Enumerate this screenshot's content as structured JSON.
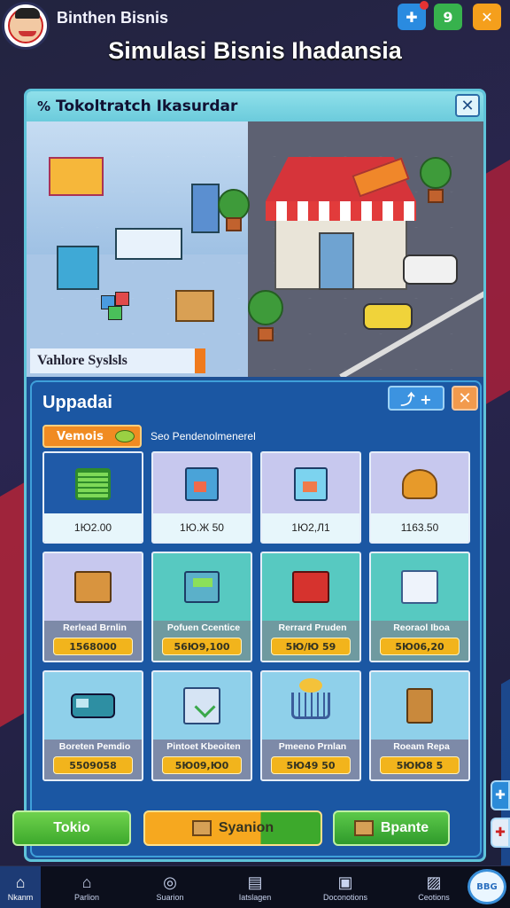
{
  "header": {
    "app_name": "Binthen Bisnis",
    "page_title": "Simulasi Bisnis Ihadansia",
    "buttons": [
      {
        "name": "puzzle-icon",
        "glyph": "✚"
      },
      {
        "name": "g-icon",
        "glyph": "9"
      },
      {
        "name": "tool-icon",
        "glyph": "✕"
      }
    ]
  },
  "window": {
    "title": "Tokoltratch Ikasurdar",
    "title_icon": "%",
    "close_glyph": "✕",
    "scene_label": "Vahlore Syslsls"
  },
  "panel": {
    "title": "Uppadai",
    "add_glyph": "⤴ +",
    "close_glyph": "✕",
    "filter_chip": "Vemois",
    "filter_desc": "Seo Pendenolmenerel",
    "items": [
      {
        "icon": "basket-icon",
        "price": "1Ю2.00",
        "tone": "sel"
      },
      {
        "icon": "red-crate-icon",
        "price": "1Ю.Ж 50",
        "tone": "t-lav"
      },
      {
        "icon": "blue-crate-icon",
        "price": "1Ю2,Л1",
        "tone": "t-lav"
      },
      {
        "icon": "sack-icon",
        "price": "1163.50",
        "tone": "t-lav"
      },
      {
        "icon": "wooden-crate-icon",
        "name": "Rerlead Brnlin",
        "cost": "1568000",
        "tone": "t-lav"
      },
      {
        "icon": "machine-icon",
        "name": "Pofuen Ccentice",
        "cost": "56Ю9,100",
        "tone": "t-teal"
      },
      {
        "icon": "red-box-icon",
        "name": "Rerrard Pruden",
        "cost": "5Ю/Ю 59",
        "tone": "t-teal"
      },
      {
        "icon": "white-box-icon",
        "name": "Reoraol Iboa",
        "cost": "5Ю06,20",
        "tone": "t-teal"
      },
      {
        "icon": "truck-icon",
        "name": "Boreten Pemdio",
        "cost": "5509058",
        "tone": "t-blue"
      },
      {
        "icon": "printer-icon",
        "name": "Pintoet Kbeoiten",
        "cost": "5Ю09,Ю0",
        "tone": "t-blue"
      },
      {
        "icon": "cart-icon",
        "name": "Pmeeno Prnlan",
        "cost": "5Ю49 50",
        "tone": "t-blue"
      },
      {
        "icon": "bag-icon",
        "name": "Roeam Repa",
        "cost": "5ЮЮ8 5",
        "tone": "t-blue"
      }
    ]
  },
  "actions": {
    "toko": "Tokio",
    "simpan": "Syanion",
    "bepante": "Bpante"
  },
  "side_tabs": [
    "✚",
    "✚"
  ],
  "nav": [
    {
      "label": "Nkanm",
      "glyph": "⌂",
      "active": true
    },
    {
      "label": "Parlion",
      "glyph": "⌂",
      "active": false
    },
    {
      "label": "Suarion",
      "glyph": "◎",
      "active": false
    },
    {
      "label": "Iatslagen",
      "glyph": "▤",
      "active": false
    },
    {
      "label": "Doconotions",
      "glyph": "▣",
      "active": false
    },
    {
      "label": "Ceotions",
      "glyph": "▨",
      "active": false
    }
  ],
  "nav_logo": "BBG"
}
